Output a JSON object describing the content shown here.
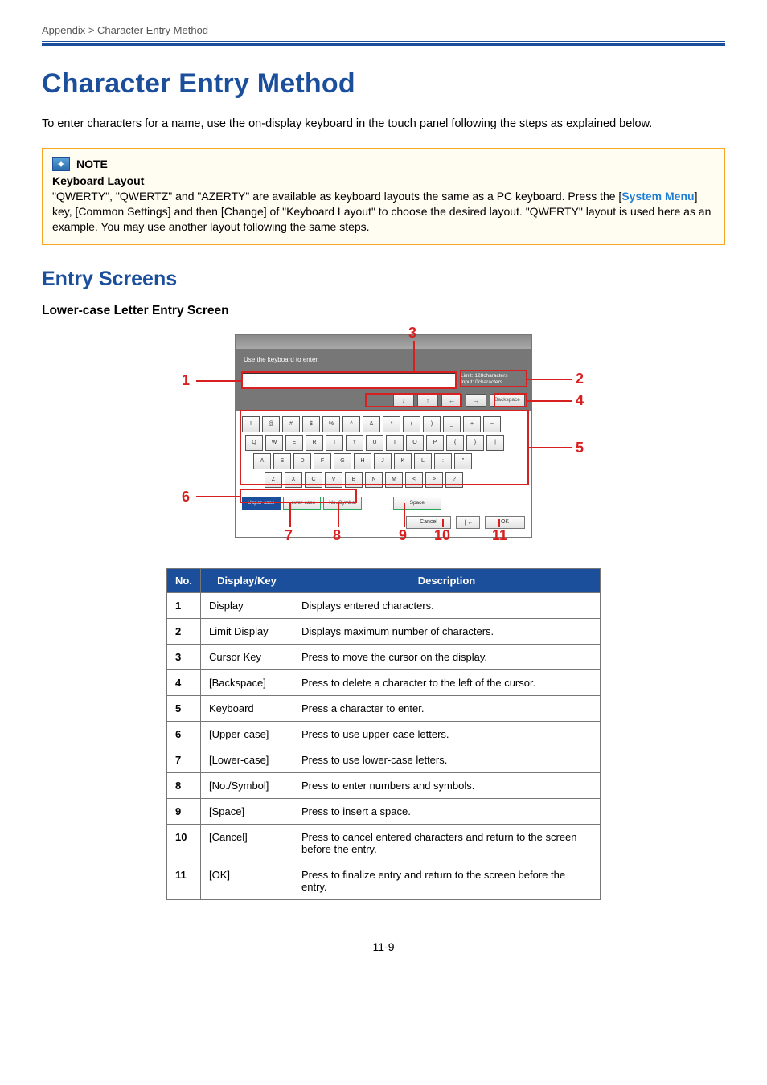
{
  "breadcrumb": "Appendix > Character Entry Method",
  "title": "Character Entry Method",
  "intro": "To enter characters for a name, use the on-display keyboard in the touch panel following the steps as explained below.",
  "note": {
    "label": "NOTE",
    "subtitle": "Keyboard Layout",
    "body_pre": "\"QWERTY\", \"QWERTZ\" and \"AZERTY\" are available as keyboard layouts the same as a PC keyboard. Press the [",
    "body_link": "System Menu",
    "body_post": "] key, [Common Settings] and then [Change] of \"Keyboard Layout\" to choose the desired layout. \"QWERTY\" layout is used here as an example. You may use another layout following the same steps."
  },
  "section": "Entry Screens",
  "subheading": "Lower-case Letter Entry Screen",
  "fig": {
    "instruction": "Use the keyboard to enter.",
    "limit_label": "Limit:",
    "limit_value": "128",
    "limit_unit": "characters",
    "input_label": "Input:",
    "input_value": "0",
    "input_unit": "characters",
    "cursor_down": "↓",
    "cursor_up": "↑",
    "cursor_left": "←",
    "cursor_right": "→",
    "backspace": "Backspace",
    "row1": [
      "!",
      "@",
      "#",
      "$",
      "%",
      "^",
      "&",
      "*",
      "(",
      ")",
      "_",
      "+",
      "~"
    ],
    "row2": [
      "Q",
      "W",
      "E",
      "R",
      "T",
      "Y",
      "U",
      "I",
      "O",
      "P",
      "{",
      "}",
      "|"
    ],
    "row3": [
      "A",
      "S",
      "D",
      "F",
      "G",
      "H",
      "J",
      "K",
      "L",
      ":",
      "\""
    ],
    "row4": [
      "Z",
      "X",
      "C",
      "V",
      "B",
      "N",
      "M",
      "<",
      ">",
      "?"
    ],
    "mode_upper": "Upper-case",
    "mode_lower": "Lower-case",
    "mode_sym": "No./Symbol",
    "space": "Space",
    "cancel": "Cancel",
    "back": "❘←",
    "ok": "OK",
    "c1": "1",
    "c2": "2",
    "c3": "3",
    "c4": "4",
    "c5": "5",
    "c6": "6",
    "c7": "7",
    "c8": "8",
    "c9": "9",
    "c10": "10",
    "c11": "11"
  },
  "table": {
    "h_no": "No.",
    "h_dk": "Display/Key",
    "h_desc": "Description",
    "rows": [
      {
        "no": "1",
        "dk": "Display",
        "desc": "Displays entered characters."
      },
      {
        "no": "2",
        "dk": "Limit Display",
        "desc": "Displays maximum number of characters."
      },
      {
        "no": "3",
        "dk": "Cursor Key",
        "desc": "Press to move the cursor on the display."
      },
      {
        "no": "4",
        "dk": "[Backspace]",
        "desc": "Press to delete a character to the left of the cursor."
      },
      {
        "no": "5",
        "dk": "Keyboard",
        "desc": "Press a character to enter."
      },
      {
        "no": "6",
        "dk": "[Upper-case]",
        "desc": "Press to use upper-case letters."
      },
      {
        "no": "7",
        "dk": "[Lower-case]",
        "desc": "Press to use lower-case letters."
      },
      {
        "no": "8",
        "dk": "[No./Symbol]",
        "desc": "Press to enter numbers and symbols."
      },
      {
        "no": "9",
        "dk": "[Space]",
        "desc": "Press to insert a space."
      },
      {
        "no": "10",
        "dk": "[Cancel]",
        "desc": "Press to cancel entered characters and return to the screen before the entry."
      },
      {
        "no": "11",
        "dk": "[OK]",
        "desc": "Press to finalize entry and return to the screen before the entry."
      }
    ]
  },
  "page_number": "11-9"
}
